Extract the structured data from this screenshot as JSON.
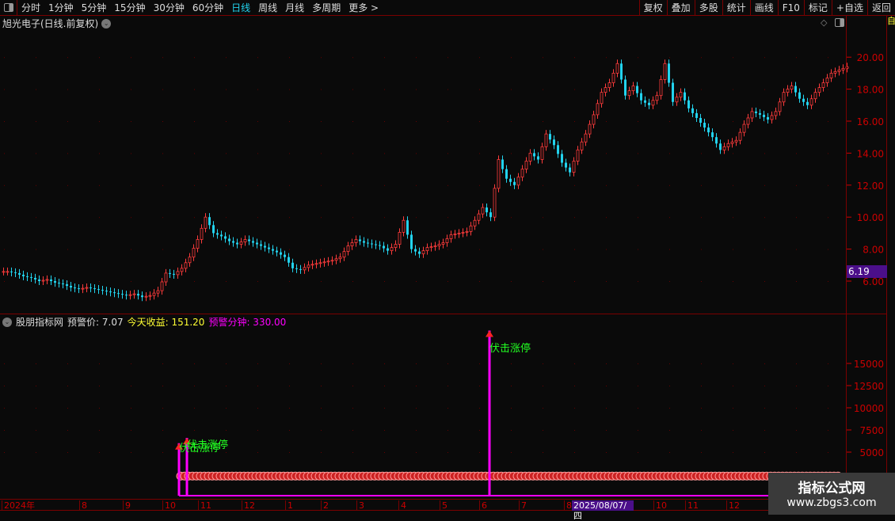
{
  "toolbar": {
    "periods": [
      {
        "label": "分时"
      },
      {
        "label": "1分钟"
      },
      {
        "label": "5分钟"
      },
      {
        "label": "15分钟"
      },
      {
        "label": "30分钟"
      },
      {
        "label": "60分钟"
      },
      {
        "label": "日线",
        "active": true
      },
      {
        "label": "周线"
      },
      {
        "label": "月线"
      },
      {
        "label": "多周期"
      },
      {
        "label": "更多 >"
      }
    ],
    "actions": [
      "复权",
      "叠加",
      "多股",
      "统计",
      "画线",
      "F10",
      "标记",
      "+自选",
      "返回"
    ]
  },
  "chart_title": "旭光电子(日线.前复权)",
  "current_price_tag": "6.19",
  "indicator": {
    "name": "股朋指标网",
    "warn_price_label": "预警价: 7.07",
    "today_gain_label": "今天收益: 151.20",
    "warn_minute_label": "预警分钟: 330.00",
    "signal_label": "伏击涨停"
  },
  "colors": {
    "up": "#ff3b3b",
    "down": "#22d3ee",
    "axis": "#cc0000",
    "signal": "#ff00ff",
    "signal_text": "#22ff22",
    "yellow": "#ffff33"
  },
  "chart_data": [
    {
      "type": "candlestick",
      "yticks": [
        "6.00",
        "8.00",
        "10.00",
        "12.00",
        "14.00",
        "16.00",
        "18.00",
        "20.00"
      ],
      "ylim": [
        4,
        21.5
      ],
      "closes": [
        6.6,
        6.5,
        6.3,
        6.2,
        6.0,
        6.1,
        5.9,
        5.8,
        5.6,
        5.5,
        5.6,
        5.5,
        5.4,
        5.3,
        5.2,
        5.1,
        5.2,
        5.0,
        5.1,
        5.4,
        6.5,
        6.4,
        6.8,
        7.5,
        8.6,
        10.0,
        9.0,
        8.8,
        8.5,
        8.3,
        8.6,
        8.4,
        8.2,
        8.0,
        7.8,
        7.5,
        6.8,
        6.7,
        7.0,
        7.1,
        7.2,
        7.3,
        7.5,
        8.2,
        8.6,
        8.4,
        8.3,
        8.2,
        7.9,
        8.3,
        9.8,
        8.0,
        7.7,
        8.1,
        8.2,
        8.4,
        8.9,
        9.0,
        9.1,
        9.8,
        10.6,
        10.0,
        13.6,
        12.4,
        12.0,
        13.0,
        14.0,
        13.6,
        15.2,
        14.5,
        13.4,
        12.8,
        14.2,
        15.2,
        16.4,
        17.8,
        18.4,
        19.6,
        17.6,
        18.2,
        17.3,
        17.0,
        17.6,
        19.6,
        17.2,
        17.8,
        16.8,
        16.2,
        15.6,
        15.0,
        14.2,
        14.6,
        14.8,
        15.8,
        16.6,
        16.4,
        16.1,
        16.6,
        17.8,
        18.2,
        17.4,
        17.0,
        17.8,
        18.4,
        19.0,
        19.2,
        19.4
      ]
    },
    {
      "type": "indicator",
      "yticks": [
        "5000",
        "7500",
        "10000",
        "12500",
        "15000"
      ],
      "ylim": [
        0,
        20000
      ],
      "spikes": [
        6000,
        6600,
        18700
      ],
      "baseline": 2300
    }
  ],
  "xaxis": {
    "labels": [
      "2024年",
      "8",
      "9",
      "10",
      "11",
      "12",
      "1",
      "2",
      "3",
      "4",
      "5",
      "6",
      "7",
      "8",
      "10",
      "11",
      "12"
    ],
    "highlight": "2025/08/07/四"
  },
  "watermark": {
    "name": "指标公式网",
    "url": "www.zbgs3.com"
  },
  "side": {
    "top": "自"
  }
}
